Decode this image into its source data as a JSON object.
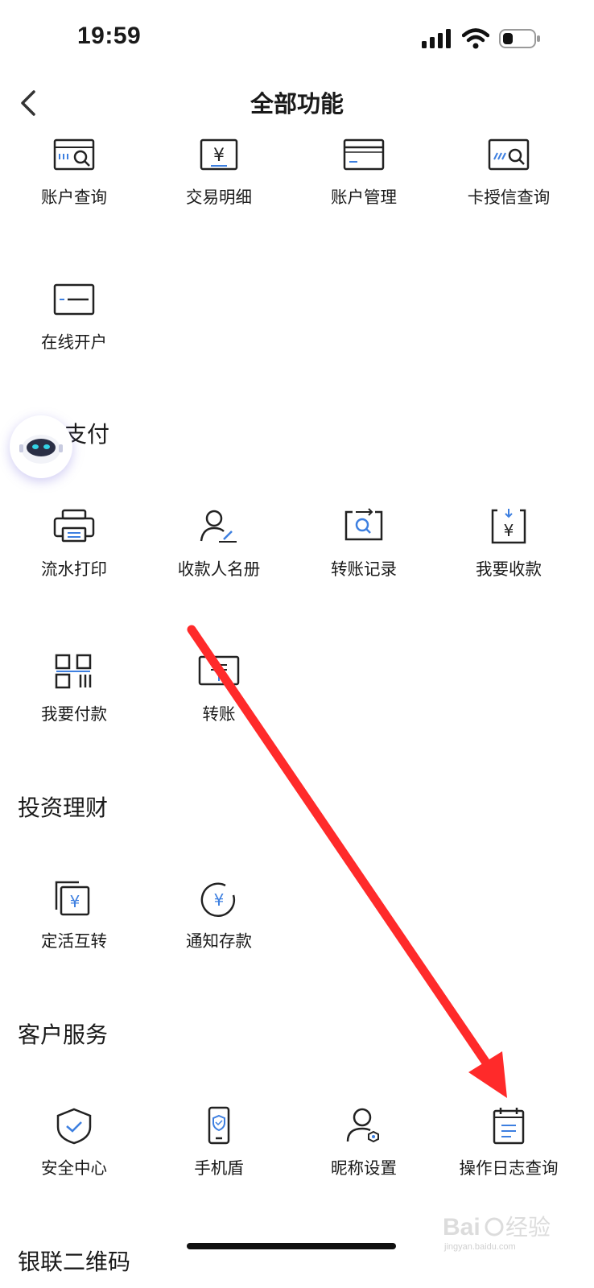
{
  "status_bar": {
    "time": "19:59"
  },
  "header": {
    "title": "全部功能"
  },
  "sections": {
    "account": {
      "items": [
        {
          "label": "账户查询",
          "icon": "account-query-icon"
        },
        {
          "label": "交易明细",
          "icon": "transaction-detail-icon"
        },
        {
          "label": "账户管理",
          "icon": "account-manage-icon"
        },
        {
          "label": "卡授信查询",
          "icon": "card-credit-query-icon"
        },
        {
          "label": "在线开户",
          "icon": "online-account-icon"
        }
      ]
    },
    "payment": {
      "title": "支付",
      "items": [
        {
          "label": "流水打印",
          "icon": "printer-icon"
        },
        {
          "label": "收款人名册",
          "icon": "payee-list-icon"
        },
        {
          "label": "转账记录",
          "icon": "transfer-record-icon"
        },
        {
          "label": "我要收款",
          "icon": "receive-money-icon"
        },
        {
          "label": "我要付款",
          "icon": "qr-pay-icon"
        },
        {
          "label": "转账",
          "icon": "transfer-icon"
        }
      ]
    },
    "invest": {
      "title": "投资理财",
      "items": [
        {
          "label": "定活互转",
          "icon": "deposit-transfer-icon"
        },
        {
          "label": "通知存款",
          "icon": "notice-deposit-icon"
        }
      ]
    },
    "service": {
      "title": "客户服务",
      "items": [
        {
          "label": "安全中心",
          "icon": "shield-icon"
        },
        {
          "label": "手机盾",
          "icon": "phone-shield-icon"
        },
        {
          "label": "昵称设置",
          "icon": "nickname-settings-icon"
        },
        {
          "label": "操作日志查询",
          "icon": "operation-log-icon"
        }
      ]
    },
    "unionpay": {
      "title": "银联二维码"
    }
  },
  "watermark": {
    "brand": "Baidu经验",
    "url": "jingyan.baidu.com"
  },
  "colors": {
    "accent": "#3d7fe0",
    "annotation_arrow": "#ff2a2a",
    "text": "#1a1a1a"
  }
}
